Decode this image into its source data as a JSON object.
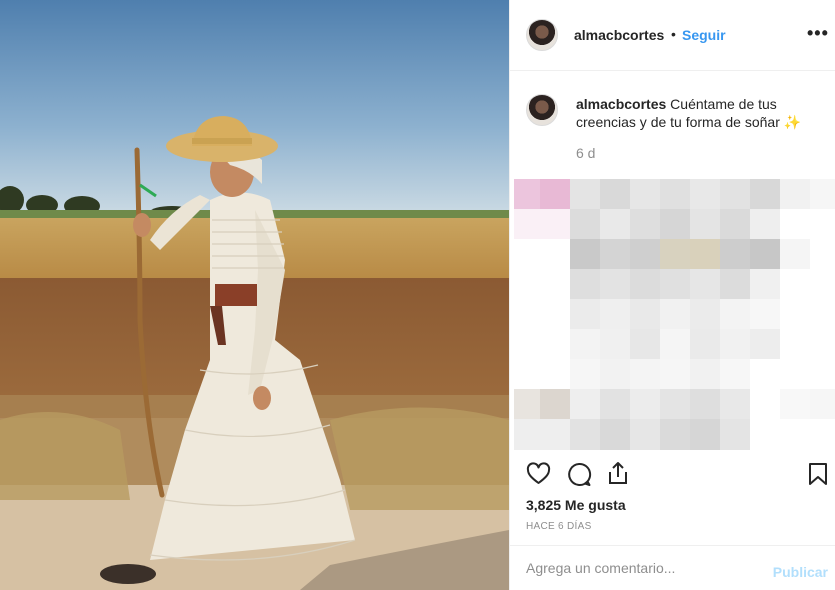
{
  "post": {
    "username": "almacbcortes",
    "separator": "•",
    "follow_label": "Seguir",
    "more_label": "•••",
    "caption_text": "Cuéntame de tus creencias y de tu forma de soñar",
    "caption_emoji": "✨",
    "age": "6 d",
    "likes": "3,825 Me gusta",
    "timestamp": "HACE 6 DÍAS",
    "comment_placeholder": "Agrega un comentario...",
    "publish_label": "Publicar"
  },
  "icons": {
    "like": "heart-icon",
    "comment": "comment-icon",
    "share": "share-icon",
    "save": "bookmark-icon",
    "more": "more-icon"
  },
  "colors": {
    "link": "#3897f0",
    "publish_disabled": "#b2dffc",
    "muted": "#8e8e8e",
    "text": "#262626"
  }
}
